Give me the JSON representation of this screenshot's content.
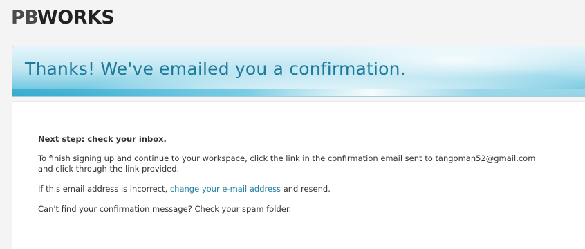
{
  "logo": {
    "pb": "PB",
    "works": "WORKS"
  },
  "banner": {
    "title": "Thanks! We've emailed you a confirmation."
  },
  "content": {
    "step_title": "Next step: check your inbox.",
    "instruction_line1": "To finish signing up and continue to your workspace, click the link in the confirmation email sent to tangoman52@gmail.com",
    "instruction_line2": "and click through the link provided.",
    "incorrect_prefix": "If this email address is incorrect, ",
    "change_email_link": "change your e-mail address",
    "incorrect_suffix": " and resend.",
    "spam_note": "Can't find your confirmation message? Check your spam folder."
  },
  "colors": {
    "banner_title": "#1e7a9a",
    "link": "#1f7fa6",
    "banner_light": "#e6f6fb",
    "banner_dark": "#4fb7d5"
  }
}
